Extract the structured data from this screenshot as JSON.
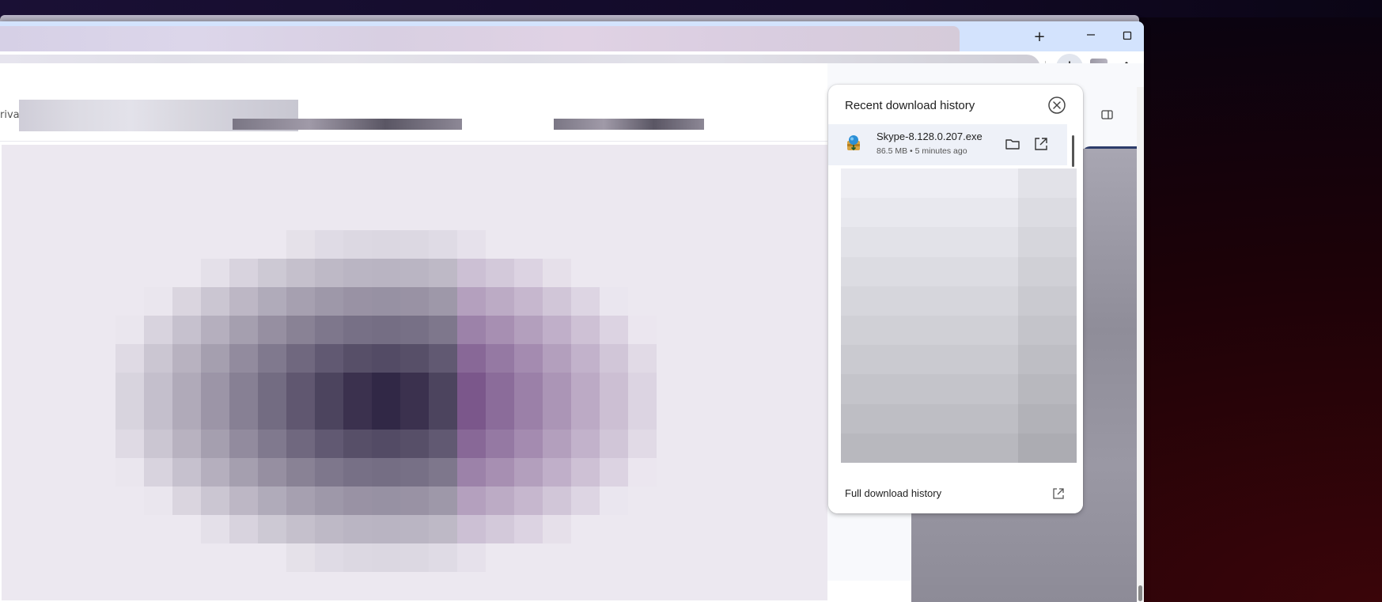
{
  "window": {
    "new_tab_label": "+",
    "minimize_label": "—",
    "maximize_label": "☐",
    "close_label": "✕"
  },
  "content": {
    "header_partial_text": "riva"
  },
  "downloads_bubble": {
    "title": "Recent download history",
    "items": [
      {
        "file_name": "Skype-8.128.0.207.exe",
        "meta": "86.5 MB • 5 minutes ago"
      }
    ],
    "footer_label": "Full download history"
  },
  "colors": {
    "tabstrip": "#d3e3fd",
    "accent": "#0b57d0",
    "bubble_item_bg": "#eef1f8"
  },
  "icons": [
    "download-icon",
    "more-vert-icon",
    "close-circle-icon",
    "folder-icon",
    "open-external-icon",
    "side-panel-icon",
    "installer-icon"
  ]
}
